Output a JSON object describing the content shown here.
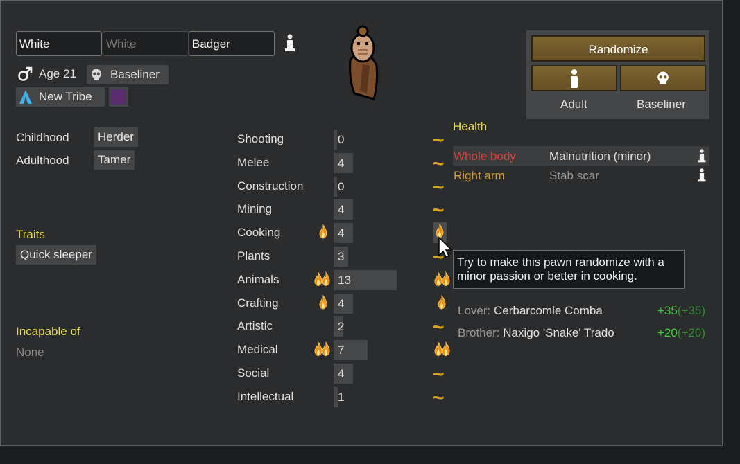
{
  "name": {
    "first": "White",
    "nick_placeholder": "White",
    "last": "Badger"
  },
  "info_icon": "info-icon",
  "pawn": {
    "gender_icon": "male-icon",
    "age": "Age 21",
    "xenotype_icon": "skull-icon",
    "xenotype": "Baseliner",
    "faction_icon": "tribe-icon",
    "faction": "New Tribe",
    "faction_color": "#5a2e6e"
  },
  "buttons": {
    "randomize": "Randomize",
    "adult_label": "Adult",
    "baseliner_label": "Baseliner"
  },
  "backstory": {
    "childhood_label": "Childhood",
    "childhood": "Herder",
    "adulthood_label": "Adulthood",
    "adulthood": "Tamer"
  },
  "traits": {
    "heading": "Traits",
    "items": [
      "Quick sleeper"
    ]
  },
  "incapable": {
    "heading": "Incapable of",
    "value": "None"
  },
  "skills": [
    {
      "name": "Shooting",
      "level": "0",
      "passion": 0,
      "fill": 0.0
    },
    {
      "name": "Melee",
      "level": "4",
      "passion": 0,
      "fill": 0.2
    },
    {
      "name": "Construction",
      "level": "0",
      "passion": 0,
      "fill": 0.0
    },
    {
      "name": "Mining",
      "level": "4",
      "passion": 0,
      "fill": 0.2
    },
    {
      "name": "Cooking",
      "level": "4",
      "passion": 1,
      "fill": 0.2
    },
    {
      "name": "Plants",
      "level": "3",
      "passion": 0,
      "fill": 0.15
    },
    {
      "name": "Animals",
      "level": "13",
      "passion": 2,
      "fill": 0.65
    },
    {
      "name": "Crafting",
      "level": "4",
      "passion": 1,
      "fill": 0.2
    },
    {
      "name": "Artistic",
      "level": "2",
      "passion": 0,
      "fill": 0.1
    },
    {
      "name": "Medical",
      "level": "7",
      "passion": 2,
      "fill": 0.35
    },
    {
      "name": "Social",
      "level": "4",
      "passion": 0,
      "fill": 0.2
    },
    {
      "name": "Intellectual",
      "level": "1",
      "passion": 0,
      "fill": 0.05
    }
  ],
  "passion_buttons": [
    0,
    0,
    0,
    0,
    1,
    0,
    2,
    1,
    0,
    2,
    0,
    0
  ],
  "health": {
    "heading": "Health",
    "rows": [
      {
        "part": "Whole body",
        "condition": "Malnutrition (minor)",
        "part_color": "#d9413d"
      },
      {
        "part": "Right arm",
        "condition": "Stab scar",
        "part_color": "#d29b2b"
      }
    ]
  },
  "tooltip": "Try to make this pawn randomize with a minor passion or better in cooking.",
  "relations": [
    {
      "type": "Lover:",
      "name": "Cerbarcomle Comba",
      "opinion": "+35",
      "base": "(+35)"
    },
    {
      "type": "Brother:",
      "name": "Naxigo 'Snake' Trado",
      "opinion": "+20",
      "base": "(+20)"
    }
  ]
}
